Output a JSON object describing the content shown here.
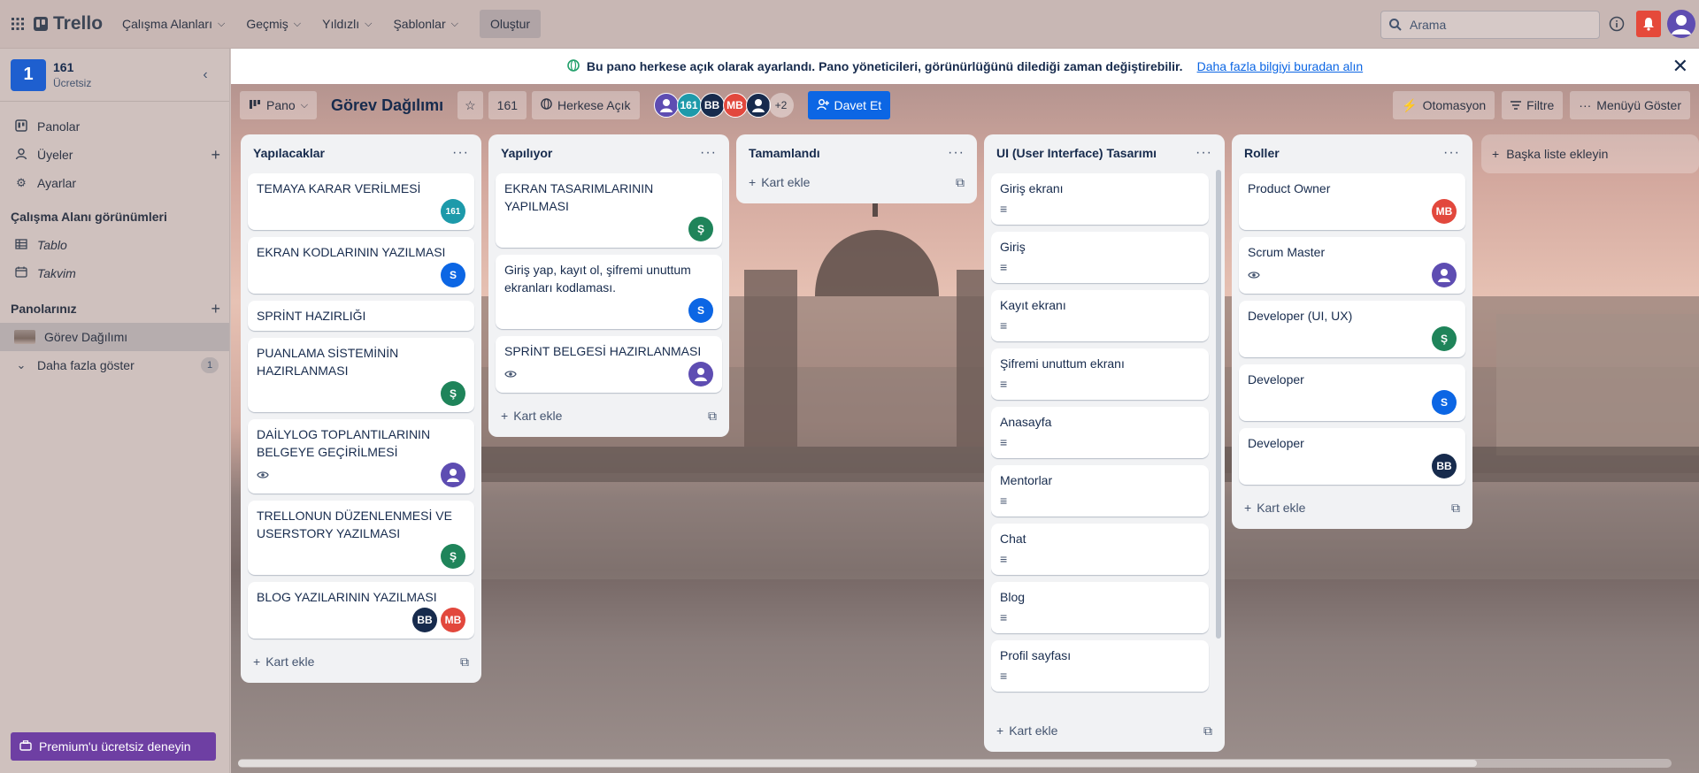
{
  "topbar": {
    "brand": "Trello",
    "nav": [
      {
        "label": "Çalışma Alanları"
      },
      {
        "label": "Geçmiş"
      },
      {
        "label": "Yıldızlı"
      },
      {
        "label": "Şablonlar"
      }
    ],
    "create_label": "Oluştur",
    "search_placeholder": "Arama",
    "notification_color": "#e5493a"
  },
  "sidebar": {
    "workspace_initial": "1",
    "workspace_name": "161",
    "workspace_plan": "Ücretsiz",
    "items": [
      {
        "label": "Panolar",
        "icon": "board-icon"
      },
      {
        "label": "Üyeler",
        "icon": "person-icon"
      },
      {
        "label": "Ayarlar",
        "icon": "gear-icon"
      }
    ],
    "views_title": "Çalışma Alanı görünümleri",
    "views": [
      {
        "label": "Tablo",
        "icon": "table-icon"
      },
      {
        "label": "Takvim",
        "icon": "calendar-icon"
      }
    ],
    "boards_title": "Panolarınız",
    "boards": [
      {
        "label": "Görev Dağılımı"
      }
    ],
    "show_more_label": "Daha fazla göster",
    "show_more_count": "1",
    "premium_label": "Premium'u ücretsiz deneyin"
  },
  "banner": {
    "message": "Bu pano herkese açık olarak ayarlandı. Pano yöneticileri, görünürlüğünü dilediği zaman değiştirebilir.",
    "link": "Daha fazla bilgiyi buradan alın"
  },
  "board": {
    "view_label": "Pano",
    "title": "Görev Dağılımı",
    "workspace": "161",
    "visibility": "Herkese Açık",
    "more_members": "+2",
    "invite_label": "Davet Et",
    "automation_label": "Otomasyon",
    "filter_label": "Filtre",
    "menu_label": "Menüyü Göster",
    "add_list_label": "Başka liste ekleyin",
    "add_card_label": "Kart ekle",
    "members": [
      {
        "initials": "",
        "color": "#5e4db2"
      },
      {
        "initials": "161",
        "color": "#1d9aaa"
      },
      {
        "initials": "BB",
        "color": "#172b4d"
      },
      {
        "initials": "MB",
        "color": "#e2483d"
      },
      {
        "initials": "",
        "color": "#172b4d"
      }
    ]
  },
  "lists": [
    {
      "title": "Yapılacaklar",
      "cards": [
        {
          "title": "TEMAYA KARAR VERİLMESİ",
          "members": [
            {
              "initials": "161",
              "color": "#1d9aaa"
            }
          ]
        },
        {
          "title": "EKRAN KODLARININ YAZILMASI",
          "members": [
            {
              "initials": "S",
              "color": "#0c66e4"
            }
          ]
        },
        {
          "title": "SPRİNT HAZIRLIĞI",
          "members": []
        },
        {
          "title": "PUANLAMA SİSTEMİNİN HAZIRLANMASI",
          "members": [
            {
              "initials": "Ş",
              "color": "#1f845a"
            }
          ]
        },
        {
          "title": "DAİLYLOG TOPLANTILARININ BELGEYE GEÇİRİLMESİ",
          "badges": [
            "eye-icon"
          ],
          "members": [
            {
              "initials": "",
              "color": "#5e4db2"
            }
          ]
        },
        {
          "title": "TRELLONUN DÜZENLENMESİ VE USERSTORY YAZILMASI",
          "members": [
            {
              "initials": "Ş",
              "color": "#1f845a"
            }
          ]
        },
        {
          "title": "BLOG YAZILARININ YAZILMASI",
          "members": [
            {
              "initials": "BB",
              "color": "#172b4d"
            },
            {
              "initials": "MB",
              "color": "#e2483d"
            }
          ]
        }
      ]
    },
    {
      "title": "Yapılıyor",
      "cards": [
        {
          "title": "EKRAN TASARIMLARININ YAPILMASI",
          "members": [
            {
              "initials": "Ş",
              "color": "#1f845a"
            }
          ]
        },
        {
          "title": "Giriş yap, kayıt ol, şifremi unuttum ekranları kodlaması.",
          "members": [
            {
              "initials": "S",
              "color": "#0c66e4"
            }
          ]
        },
        {
          "title": "SPRİNT BELGESİ HAZIRLANMASI",
          "badges": [
            "eye-icon"
          ],
          "members": [
            {
              "initials": "",
              "color": "#5e4db2"
            }
          ]
        }
      ]
    },
    {
      "title": "Tamamlandı",
      "cards": []
    },
    {
      "title": "UI (User Interface) Tasarımı",
      "cards": [
        {
          "title": "Giriş ekranı",
          "badges": [
            "description-icon"
          ],
          "members": []
        },
        {
          "title": "Giriş",
          "badges": [
            "description-icon"
          ],
          "members": []
        },
        {
          "title": "Kayıt ekranı",
          "badges": [
            "description-icon"
          ],
          "members": []
        },
        {
          "title": "Şifremi unuttum ekranı",
          "badges": [
            "description-icon"
          ],
          "members": []
        },
        {
          "title": "Anasayfa",
          "badges": [
            "description-icon"
          ],
          "members": []
        },
        {
          "title": "Mentorlar",
          "badges": [
            "description-icon"
          ],
          "members": []
        },
        {
          "title": "Chat",
          "badges": [
            "description-icon"
          ],
          "members": []
        },
        {
          "title": "Blog",
          "badges": [
            "description-icon"
          ],
          "members": []
        },
        {
          "title": "Profil sayfası",
          "badges": [
            "description-icon"
          ],
          "members": []
        }
      ]
    },
    {
      "title": "Roller",
      "cards": [
        {
          "title": "Product Owner",
          "members": [
            {
              "initials": "MB",
              "color": "#e2483d"
            }
          ]
        },
        {
          "title": "Scrum Master",
          "badges": [
            "eye-icon"
          ],
          "members": [
            {
              "initials": "",
              "color": "#5e4db2"
            }
          ]
        },
        {
          "title": "Developer (UI, UX)",
          "members": [
            {
              "initials": "Ş",
              "color": "#1f845a"
            }
          ]
        },
        {
          "title": "Developer",
          "members": [
            {
              "initials": "S",
              "color": "#0c66e4"
            }
          ]
        },
        {
          "title": "Developer",
          "members": [
            {
              "initials": "BB",
              "color": "#172b4d"
            }
          ]
        }
      ]
    }
  ]
}
